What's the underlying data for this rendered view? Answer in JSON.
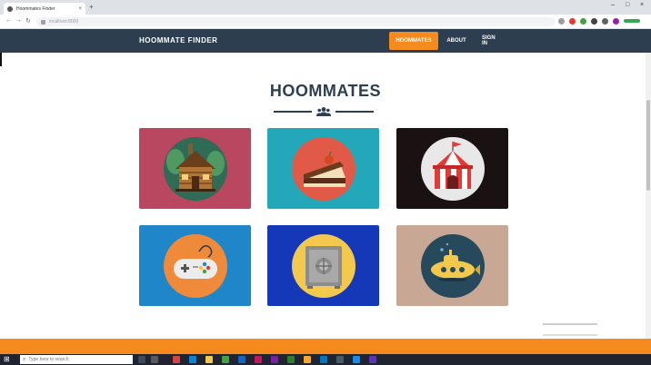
{
  "browser": {
    "tab_title": "Hoommates Finder",
    "tab_close": "×",
    "new_tab": "+",
    "url": "localhost:8000",
    "back": "←",
    "forward": "→",
    "reload": "↻",
    "minimize": "–",
    "maximize": "□",
    "close": "×"
  },
  "navbar": {
    "brand": "HOOMMATE FINDER",
    "links": [
      {
        "label": "HOOMMATES",
        "active": true
      },
      {
        "label": "ABOUT",
        "active": false
      },
      {
        "label": "SIGN IN",
        "active": false
      }
    ],
    "accent_color": "#f58a1f",
    "bg_color": "#2c3e50"
  },
  "main": {
    "heading": "HOOMMATES",
    "divider_icon": "users-icon",
    "cards": [
      {
        "icon": "cabin-icon",
        "bg": "#b8475f"
      },
      {
        "icon": "cake-icon",
        "bg": "#22a8b8"
      },
      {
        "icon": "circus-tent-icon",
        "bg": "#1a1212"
      },
      {
        "icon": "game-controller-icon",
        "bg": "#1f86c9"
      },
      {
        "icon": "safe-icon",
        "bg": "#1538b8"
      },
      {
        "icon": "submarine-icon",
        "bg": "#c8a894"
      }
    ]
  },
  "taskbar": {
    "start_icon": "⊞",
    "search_icon": "⌕",
    "search_placeholder": "Type here to search"
  }
}
